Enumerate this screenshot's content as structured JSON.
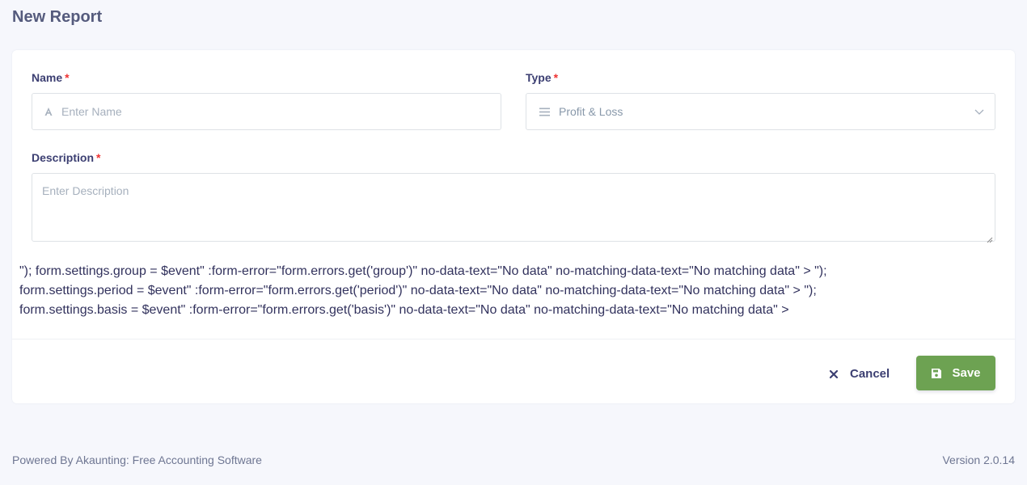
{
  "page": {
    "title": "New Report"
  },
  "form": {
    "name": {
      "label": "Name",
      "required_mark": "*",
      "placeholder": "Enter Name",
      "icon": "font-icon"
    },
    "type": {
      "label": "Type",
      "required_mark": "*",
      "value": "Profit & Loss",
      "icon": "bars-icon"
    },
    "description": {
      "label": "Description",
      "required_mark": "*",
      "placeholder": "Enter Description"
    },
    "raw_lines": [
      "\"); form.settings.group = $event\" :form-error=\"form.errors.get('group')\" no-data-text=\"No data\" no-matching-data-text=\"No matching data\" > \");",
      "form.settings.period = $event\" :form-error=\"form.errors.get('period')\" no-data-text=\"No data\" no-matching-data-text=\"No matching data\" > \");",
      "form.settings.basis = $event\" :form-error=\"form.errors.get('basis')\" no-data-text=\"No data\" no-matching-data-text=\"No matching data\" >"
    ]
  },
  "actions": {
    "cancel_label": "Cancel",
    "save_label": "Save"
  },
  "footer": {
    "powered_by": "Powered By Akaunting: Free Accounting Software",
    "version": "Version 2.0.14"
  },
  "colors": {
    "accent_green": "#6da252",
    "required_red": "#ef3232",
    "text_primary": "#3c3f72"
  }
}
